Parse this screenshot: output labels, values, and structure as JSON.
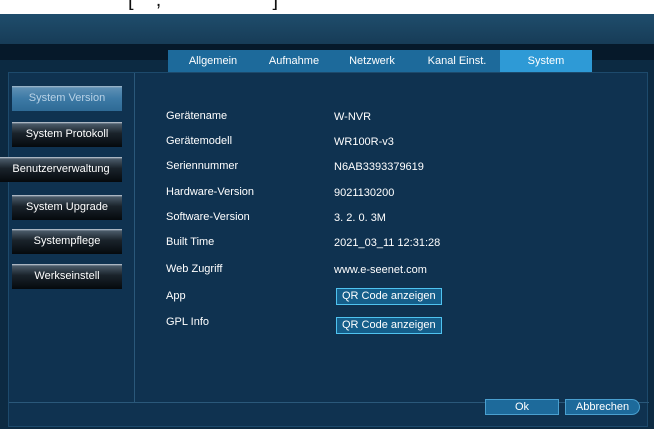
{
  "top_fragment": "[    ,                    ]",
  "tabs": [
    {
      "label": "Allgemein",
      "active": false
    },
    {
      "label": "Aufnahme",
      "active": false
    },
    {
      "label": "Netzwerk",
      "active": false
    },
    {
      "label": "Kanal Einst.",
      "active": false
    },
    {
      "label": "System",
      "active": true
    }
  ],
  "sidebar": [
    {
      "label": "System Version",
      "selected": true
    },
    {
      "label": "System Protokoll",
      "selected": false
    },
    {
      "label": "Benutzerverwaltung",
      "selected": false
    },
    {
      "label": "System Upgrade",
      "selected": false
    },
    {
      "label": "Systempflege",
      "selected": false
    },
    {
      "label": "Werkseinstell",
      "selected": false
    }
  ],
  "info": {
    "device_name": {
      "label": "Gerätename",
      "value": "W-NVR"
    },
    "device_model": {
      "label": "Gerätemodell",
      "value": "WR100R-v3"
    },
    "serial": {
      "label": "Seriennummer",
      "value": "N6AB3393379619"
    },
    "hardware": {
      "label": "Hardware-Version",
      "value": "9021130200"
    },
    "software": {
      "label": "Software-Version",
      "value": "3. 2. 0. 3M"
    },
    "built": {
      "label": "Built Time",
      "value": "2021_03_11  12:31:28"
    },
    "web": {
      "label": "Web Zugriff",
      "value": "www.e-seenet.com"
    },
    "app": {
      "label": "App",
      "button": "QR Code anzeigen"
    },
    "gpl": {
      "label": "GPL Info",
      "button": "QR Code anzeigen"
    }
  },
  "footer": {
    "ok_label": "Ok",
    "cancel_label": "Abbrechen"
  },
  "colors": {
    "background": "#0c2a42",
    "tab": "#1d6a9b",
    "tab_active": "#2e9ad6",
    "button_border": "#4fc3f0"
  }
}
